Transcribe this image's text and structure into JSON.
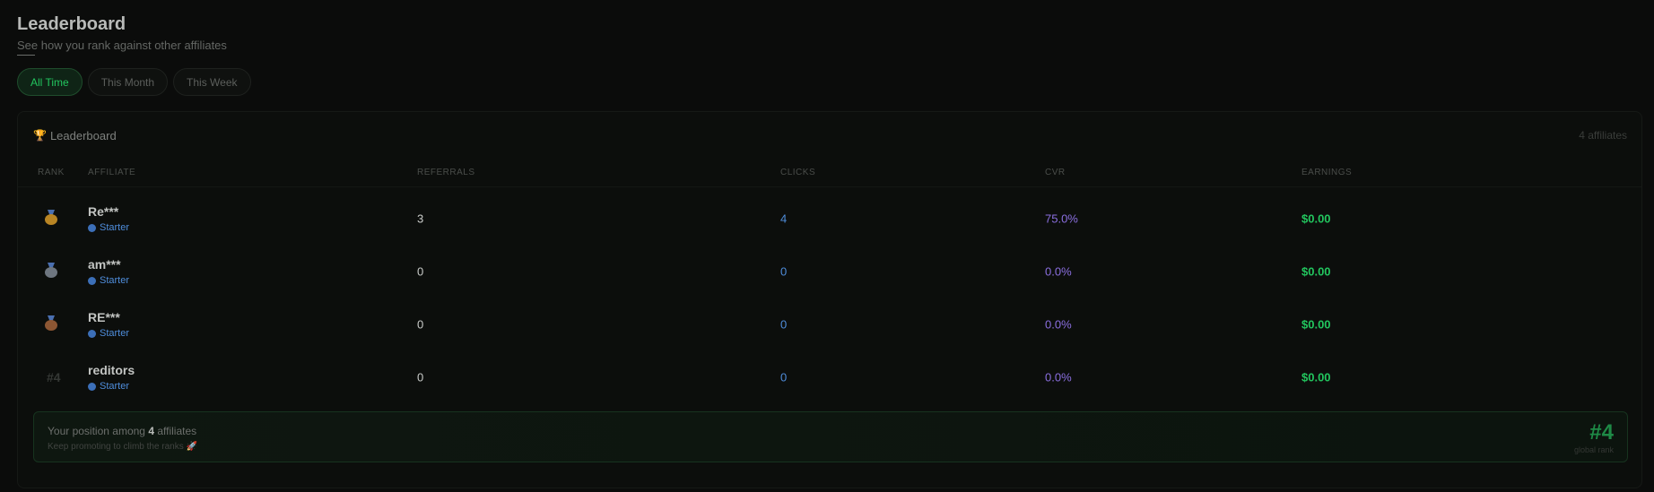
{
  "header": {
    "title": "Leaderboard",
    "subtitle": "See how you rank against other affiliates"
  },
  "tabs": [
    {
      "label": "All Time",
      "active": true
    },
    {
      "label": "This Month",
      "active": false
    },
    {
      "label": "This Week",
      "active": false
    }
  ],
  "card": {
    "icon": "trophy-icon",
    "title": "Leaderboard",
    "count": "4 affiliates"
  },
  "columns": {
    "rank": "RANK",
    "affiliate": "AFFILIATE",
    "referrals": "REFERRALS",
    "clicks": "CLICKS",
    "cvr": "CVR",
    "earnings": "EARNINGS"
  },
  "rows": [
    {
      "rank_icon": "gold-medal-icon",
      "rank_text": "",
      "name": "Re***",
      "tier": "Starter",
      "referrals": "3",
      "clicks": "4",
      "cvr": "75.0%",
      "earnings": "$0.00"
    },
    {
      "rank_icon": "silver-medal-icon",
      "rank_text": "",
      "name": "am***",
      "tier": "Starter",
      "referrals": "0",
      "clicks": "0",
      "cvr": "0.0%",
      "earnings": "$0.00"
    },
    {
      "rank_icon": "bronze-medal-icon",
      "rank_text": "",
      "name": "RE***",
      "tier": "Starter",
      "referrals": "0",
      "clicks": "0",
      "cvr": "0.0%",
      "earnings": "$0.00"
    },
    {
      "rank_icon": "",
      "rank_text": "#4",
      "name": "reditors",
      "tier": "Starter",
      "referrals": "0",
      "clicks": "0",
      "cvr": "0.0%",
      "earnings": "$0.00"
    }
  ],
  "position": {
    "prefix": "Your position among",
    "count": "4",
    "suffix": "affiliates",
    "hint": "Keep promoting to climb the ranks 🚀",
    "rank": "#4",
    "rank_label": "global rank"
  },
  "colors": {
    "accent": "#22c55e",
    "clicks": "#4f8ddb",
    "cvr": "#8b6fe0",
    "tier": "#4f8ddb"
  }
}
